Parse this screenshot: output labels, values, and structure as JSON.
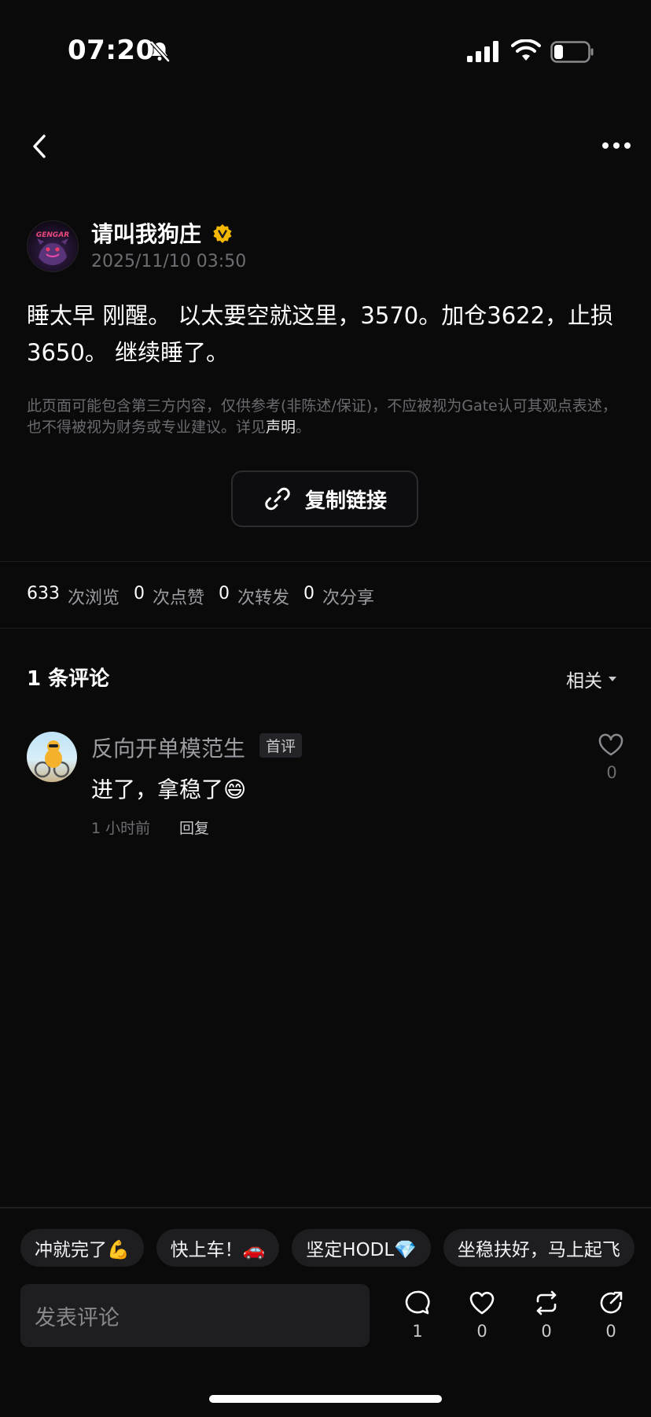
{
  "status_bar": {
    "time": "07:20"
  },
  "post": {
    "author": "请叫我狗庄",
    "avatar_text": "GENGAR",
    "date": "2025/11/10 03:50",
    "body": "睡太早 刚醒。 以太要空就这里，3570。加仓3622，止损3650。 继续睡了。",
    "disclaimer": "此页面可能包含第三方内容，仅供参考(非陈述/保证)，不应被视为Gate认可其观点表述，也不得被视为财务或专业建议。详见",
    "disclaimer_link": "声明",
    "disclaimer_end": "。",
    "copy_link_label": "复制链接"
  },
  "stats": {
    "views": "633",
    "views_label": "次浏览",
    "likes": "0",
    "likes_label": "次点赞",
    "reposts": "0",
    "reposts_label": "次转发",
    "shares": "0",
    "shares_label": "次分享"
  },
  "comments": {
    "title": "1 条评论",
    "sort_label": "相关",
    "items": [
      {
        "user": "反向开单模范生",
        "badge": "首评",
        "text": "进了，拿稳了😄",
        "time": "1 小时前",
        "reply_label": "回复",
        "likes": "0"
      }
    ]
  },
  "quick_replies": [
    "冲就完了💪",
    "快上车！🚗",
    "坚定HODL💎",
    "坐稳扶好，马上起飞"
  ],
  "composer": {
    "placeholder": "发表评论",
    "comment_count": "1",
    "like_count": "0",
    "repost_count": "0",
    "share_count": "0"
  },
  "colors": {
    "background": "#0a0a0b",
    "verified": "#f5b800",
    "muted": "#6d6d72"
  }
}
